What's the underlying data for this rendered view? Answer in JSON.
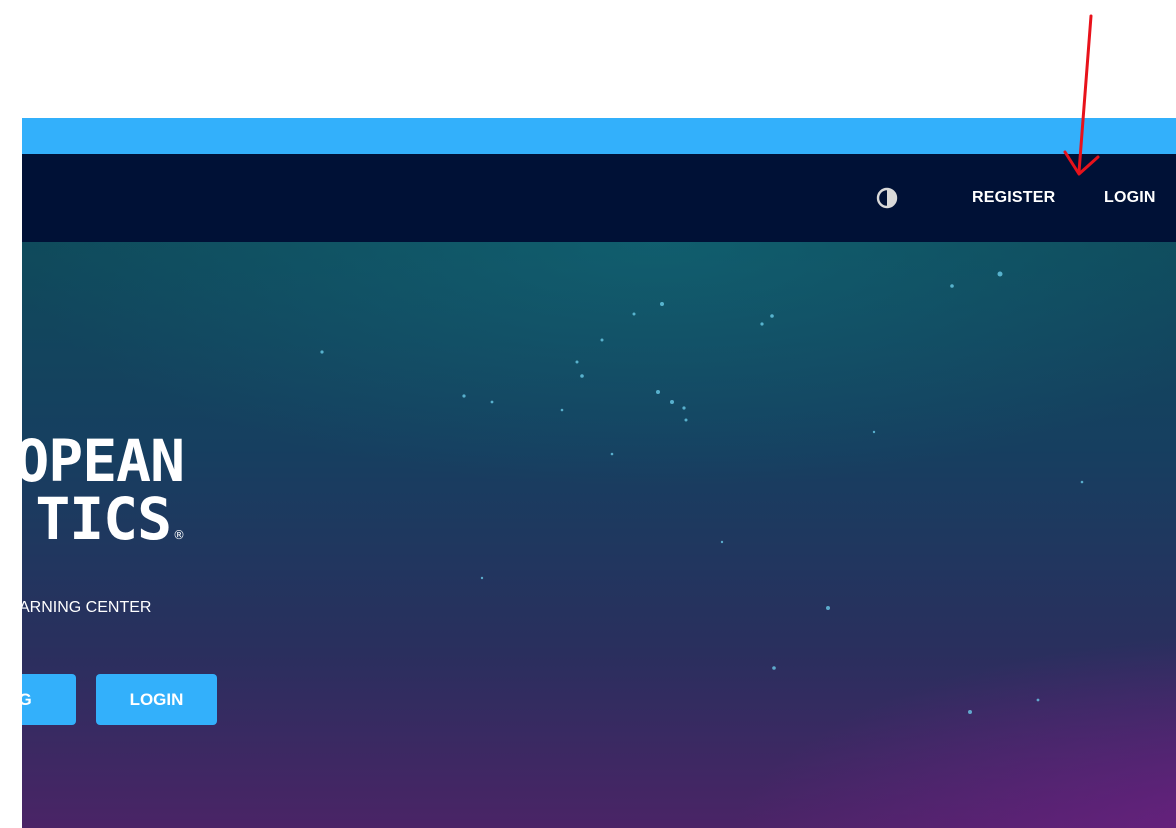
{
  "nav": {
    "contrast_icon": "contrast-icon",
    "register_label": "REGISTER",
    "login_label": "LOGIN"
  },
  "hero": {
    "logo_line1": "OPEAN",
    "logo_line2": "TICS",
    "logo_reg": "®",
    "subtitle": "ARNING CENTER",
    "button_left_label": "NG",
    "button_login_label": "LOGIN"
  },
  "annotation": {
    "arrow_icon": "red-arrow-annotation-icon",
    "arrow_color": "#e8121b"
  },
  "colors": {
    "top_strip": "#33b0fb",
    "navbar": "#001136",
    "button": "#33b0fb"
  }
}
